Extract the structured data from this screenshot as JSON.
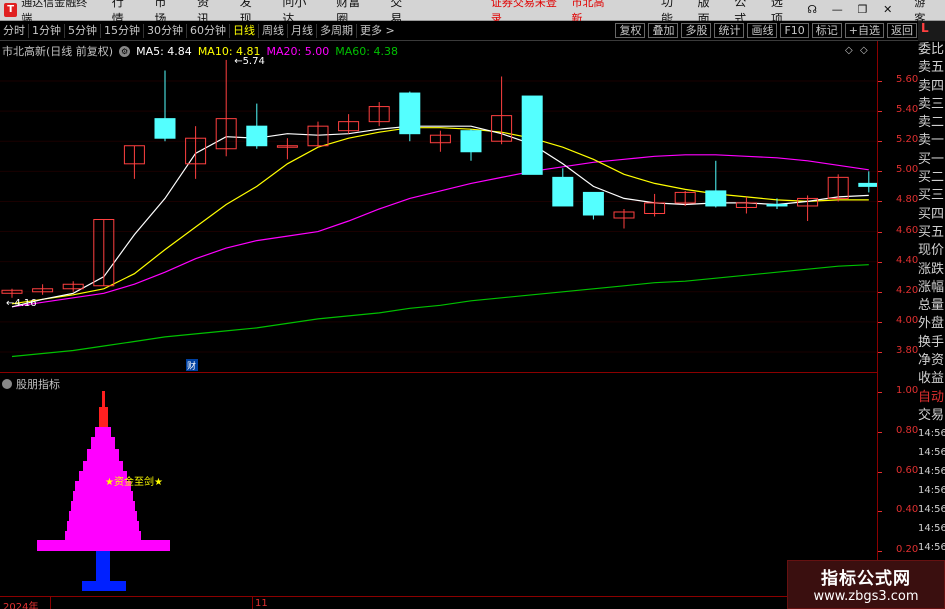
{
  "menubar": {
    "logo": "T",
    "app_name": "通达信金融终端",
    "menus": [
      "行情",
      "市场",
      "资讯",
      "发现",
      "问小达",
      "财富圈",
      "交易"
    ],
    "status": "证券交易未登录",
    "stock_name": "市北高新",
    "right_menus": [
      "功能",
      "版面",
      "公式",
      "选项"
    ],
    "guest": "游客"
  },
  "toolbar": {
    "periods": [
      "分时",
      "1分钟",
      "5分钟",
      "15分钟",
      "30分钟",
      "60分钟",
      "日线",
      "周线",
      "月线",
      "多周期",
      "更多 >"
    ],
    "active_period": "日线",
    "right_buttons": [
      "复权",
      "叠加",
      "多股",
      "统计",
      "画线",
      "F10",
      "标记",
      "+自选",
      "返回"
    ]
  },
  "main_info": {
    "stock": "市北高新(日线 前复权)",
    "ma5": "MA5: 4.84",
    "ma10": "MA10: 4.81",
    "ma20": "MA20: 5.00",
    "ma60": "MA60: 4.38",
    "colors": {
      "ma5": "#ffffff",
      "ma10": "#ffff00",
      "ma20": "#ff00ff",
      "ma60": "#00c000"
    }
  },
  "sub_info": {
    "indicator": "股朋指标"
  },
  "price_axis": [
    "5.60",
    "5.40",
    "5.20",
    "5.00",
    "4.80",
    "4.60",
    "4.40",
    "4.20",
    "4.00",
    "3.80"
  ],
  "sub_axis": [
    "1.00",
    "0.80",
    "0.60",
    "0.40",
    "0.20"
  ],
  "annotations": {
    "high": "5.74",
    "low": "4.16",
    "cai": "财",
    "signal": "★资金至剑★"
  },
  "time_axis": {
    "year": "2024年",
    "month": "11"
  },
  "quote_panel": {
    "top": "L",
    "rows": [
      "委比",
      "卖五",
      "卖四",
      "卖三",
      "卖二",
      "卖一",
      "买一",
      "买二",
      "买三",
      "买四",
      "买五",
      "现价",
      "涨跌",
      "涨幅",
      "总量",
      "外盘",
      "换手",
      "净资",
      "收益",
      "自动",
      "交易",
      "14:56",
      "14:56",
      "14:56",
      "14:56",
      "14:56",
      "14:56",
      "14:56"
    ]
  },
  "watermark": {
    "line1": "指标公式网",
    "line2": "www.zbgs3.com"
  },
  "chart_data": {
    "type": "candlestick",
    "price_range": [
      3.7,
      5.78
    ],
    "candles": [
      {
        "o": 4.19,
        "c": 4.21,
        "h": 4.22,
        "l": 4.16
      },
      {
        "o": 4.2,
        "c": 4.22,
        "h": 4.25,
        "l": 4.18
      },
      {
        "o": 4.22,
        "c": 4.25,
        "h": 4.27,
        "l": 4.2
      },
      {
        "o": 4.24,
        "c": 4.68,
        "h": 4.68,
        "l": 4.24
      },
      {
        "o": 5.05,
        "c": 5.17,
        "h": 5.17,
        "l": 4.95
      },
      {
        "o": 5.35,
        "c": 5.22,
        "h": 5.67,
        "l": 5.2
      },
      {
        "o": 5.05,
        "c": 5.22,
        "h": 5.3,
        "l": 4.95
      },
      {
        "o": 5.15,
        "c": 5.35,
        "h": 5.74,
        "l": 5.1
      },
      {
        "o": 5.3,
        "c": 5.17,
        "h": 5.45,
        "l": 5.15
      },
      {
        "o": 5.17,
        "c": 5.17,
        "h": 5.22,
        "l": 5.08
      },
      {
        "o": 5.17,
        "c": 5.3,
        "h": 5.33,
        "l": 5.16
      },
      {
        "o": 5.27,
        "c": 5.33,
        "h": 5.38,
        "l": 5.25
      },
      {
        "o": 5.33,
        "c": 5.43,
        "h": 5.46,
        "l": 5.3
      },
      {
        "o": 5.52,
        "c": 5.25,
        "h": 5.53,
        "l": 5.2
      },
      {
        "o": 5.19,
        "c": 5.24,
        "h": 5.27,
        "l": 5.13
      },
      {
        "o": 5.27,
        "c": 5.13,
        "h": 5.28,
        "l": 5.07
      },
      {
        "o": 5.2,
        "c": 5.37,
        "h": 5.63,
        "l": 5.18
      },
      {
        "o": 5.5,
        "c": 4.98,
        "h": 5.5,
        "l": 4.98
      },
      {
        "o": 4.96,
        "c": 4.77,
        "h": 5.02,
        "l": 4.77
      },
      {
        "o": 4.86,
        "c": 4.71,
        "h": 4.86,
        "l": 4.68
      },
      {
        "o": 4.69,
        "c": 4.73,
        "h": 4.75,
        "l": 4.62
      },
      {
        "o": 4.72,
        "c": 4.79,
        "h": 4.85,
        "l": 4.7
      },
      {
        "o": 4.79,
        "c": 4.86,
        "h": 4.87,
        "l": 4.77
      },
      {
        "o": 4.87,
        "c": 4.77,
        "h": 5.07,
        "l": 4.76
      },
      {
        "o": 4.76,
        "c": 4.79,
        "h": 4.83,
        "l": 4.72
      },
      {
        "o": 4.78,
        "c": 4.77,
        "h": 4.82,
        "l": 4.75
      },
      {
        "o": 4.77,
        "c": 4.82,
        "h": 4.84,
        "l": 4.67
      },
      {
        "o": 4.82,
        "c": 4.96,
        "h": 4.98,
        "l": 4.8
      },
      {
        "o": 4.92,
        "c": 4.9,
        "h": 5.0,
        "l": 4.86
      }
    ],
    "ma5": [
      4.1,
      4.15,
      4.19,
      4.3,
      4.58,
      4.82,
      5.12,
      5.23,
      5.22,
      5.25,
      5.24,
      5.25,
      5.28,
      5.3,
      5.3,
      5.3,
      5.25,
      5.18,
      5.05,
      4.9,
      4.82,
      4.79,
      4.78,
      4.79,
      4.79,
      4.78,
      4.8,
      4.83,
      4.84
    ],
    "ma10": [
      4.12,
      4.15,
      4.18,
      4.22,
      4.32,
      4.48,
      4.63,
      4.78,
      4.9,
      5.05,
      5.16,
      5.22,
      5.26,
      5.29,
      5.29,
      5.28,
      5.26,
      5.22,
      5.16,
      5.08,
      4.98,
      4.92,
      4.88,
      4.85,
      4.83,
      4.81,
      4.8,
      4.81,
      4.81
    ],
    "ma20": [
      4.1,
      4.13,
      4.16,
      4.19,
      4.25,
      4.33,
      4.42,
      4.49,
      4.54,
      4.57,
      4.6,
      4.67,
      4.75,
      4.82,
      4.87,
      4.92,
      4.96,
      5.0,
      5.03,
      5.06,
      5.08,
      5.1,
      5.11,
      5.11,
      5.1,
      5.09,
      5.07,
      5.04,
      5.01
    ],
    "ma60": [
      3.77,
      3.79,
      3.81,
      3.84,
      3.87,
      3.9,
      3.92,
      3.94,
      3.96,
      3.99,
      4.02,
      4.04,
      4.06,
      4.09,
      4.11,
      4.14,
      4.16,
      4.18,
      4.2,
      4.22,
      4.24,
      4.26,
      4.27,
      4.29,
      4.31,
      4.33,
      4.35,
      4.37,
      4.38
    ],
    "sub_range": [
      0.1,
      1.05
    ]
  }
}
